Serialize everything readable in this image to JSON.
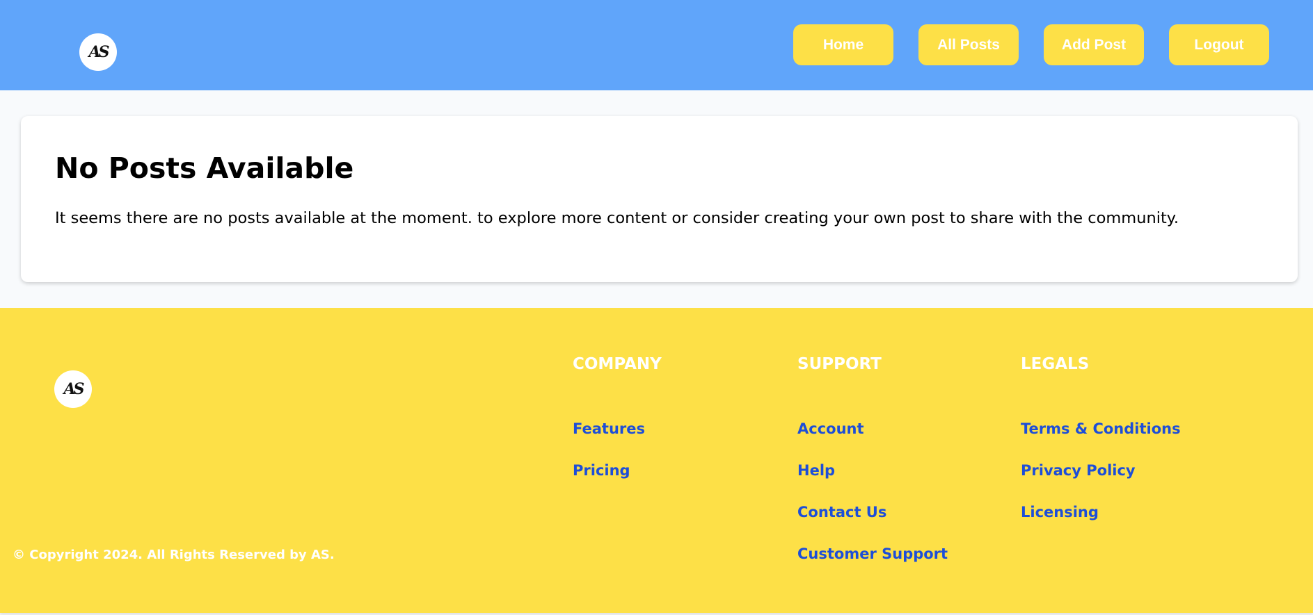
{
  "header": {
    "logo_text": "AS",
    "nav": [
      "Home",
      "All Posts",
      "Add Post",
      "Logout"
    ]
  },
  "main": {
    "title": "No Posts Available",
    "message": "It seems there are no posts available at the moment. to explore more content or consider creating your own post to share with the community."
  },
  "footer": {
    "logo_text": "AS",
    "columns": [
      {
        "heading": "COMPANY",
        "links": [
          "Features",
          "Pricing"
        ]
      },
      {
        "heading": "SUPPORT",
        "links": [
          "Account",
          "Help",
          "Contact Us",
          "Customer Support"
        ]
      },
      {
        "heading": "LEGALS",
        "links": [
          "Terms & Conditions",
          "Privacy Policy",
          "Licensing"
        ]
      }
    ],
    "copyright": "© Copyright 2024. All Rights Reserved by AS."
  },
  "colors": {
    "header": "#60a5fa",
    "accent": "#fde047",
    "link": "#1d4ed8"
  }
}
